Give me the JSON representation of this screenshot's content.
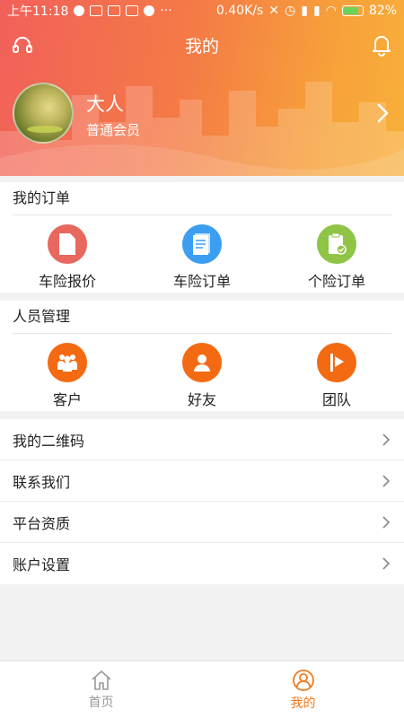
{
  "status_bar": {
    "time": "上午11:18",
    "dots": "···",
    "speed": "0.40K/s",
    "battery": "82%"
  },
  "nav": {
    "title": "我的",
    "left_icon": "headset-icon",
    "right_icon": "bell-icon"
  },
  "profile": {
    "name": "大人",
    "level": "普通会员"
  },
  "orders": {
    "title": "我的订单",
    "items": [
      {
        "label": "车险报价",
        "icon": "document-icon",
        "color": "#e8675f"
      },
      {
        "label": "车险订单",
        "icon": "list-document-icon",
        "color": "#3b9ef0"
      },
      {
        "label": "个险订单",
        "icon": "clipboard-check-icon",
        "color": "#8fc447"
      }
    ]
  },
  "people": {
    "title": "人员管理",
    "items": [
      {
        "label": "客户",
        "icon": "group-icon",
        "color": "#f46a12"
      },
      {
        "label": "好友",
        "icon": "person-icon",
        "color": "#f46a12"
      },
      {
        "label": "团队",
        "icon": "flag-icon",
        "color": "#f46a12"
      }
    ]
  },
  "menu": [
    {
      "label": "我的二维码"
    },
    {
      "label": "联系我们"
    },
    {
      "label": "平台资质"
    },
    {
      "label": "账户设置"
    }
  ],
  "tabbar": {
    "tabs": [
      {
        "label": "首页",
        "icon": "home-icon",
        "active": false
      },
      {
        "label": "我的",
        "icon": "user-circle-icon",
        "active": true
      }
    ],
    "active_color": "#f47a1c",
    "inactive_color": "#999999"
  }
}
